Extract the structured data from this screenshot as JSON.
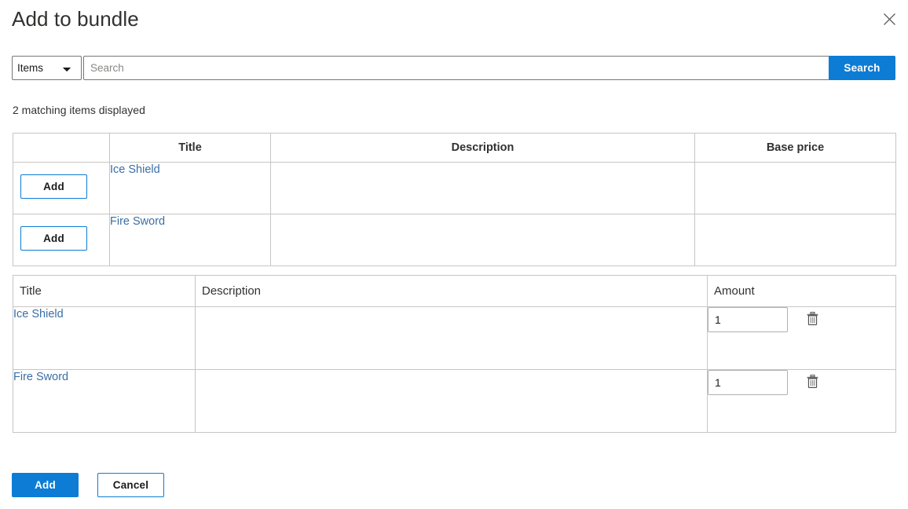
{
  "dialog": {
    "title": "Add to bundle",
    "close_icon": "close-icon"
  },
  "search": {
    "scope_selected": "Items",
    "scope_options": [
      "Items"
    ],
    "placeholder": "Search",
    "value": "",
    "button_label": "Search"
  },
  "status": {
    "text": "2 matching items displayed"
  },
  "results_table": {
    "columns": [
      "",
      "Title",
      "Description",
      "Base price"
    ],
    "rows": [
      {
        "add_label": "Add",
        "title": "Ice Shield",
        "description": "",
        "base_price": ""
      },
      {
        "add_label": "Add",
        "title": "Fire Sword",
        "description": "",
        "base_price": ""
      }
    ]
  },
  "selected_table": {
    "columns": [
      "Title",
      "Description",
      "Amount"
    ],
    "rows": [
      {
        "title": "Ice Shield",
        "description": "",
        "amount": "1",
        "delete_icon": "trash-icon"
      },
      {
        "title": "Fire Sword",
        "description": "",
        "amount": "1",
        "delete_icon": "trash-icon"
      }
    ]
  },
  "footer": {
    "add_label": "Add",
    "cancel_label": "Cancel"
  },
  "colors": {
    "accent": "#0c7cd5",
    "link": "#3a6ea5",
    "text": "#323130",
    "border": "#c8c6c4"
  }
}
